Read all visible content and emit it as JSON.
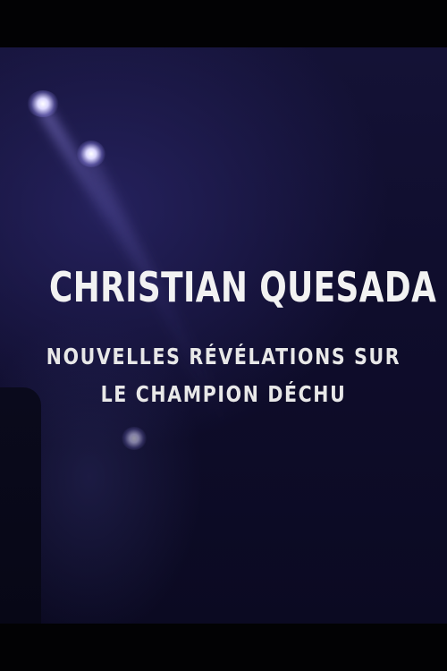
{
  "poster": {
    "title": "CHRISTIAN QUESADA",
    "subtitle_line1": "NOUVELLES RÉVÉLATIONS SUR",
    "subtitle_line2": "LE CHAMPION DÉCHU"
  },
  "colors": {
    "background": "#0f0d2c",
    "text": "#f2f2f2",
    "letterbox": "#020204"
  }
}
